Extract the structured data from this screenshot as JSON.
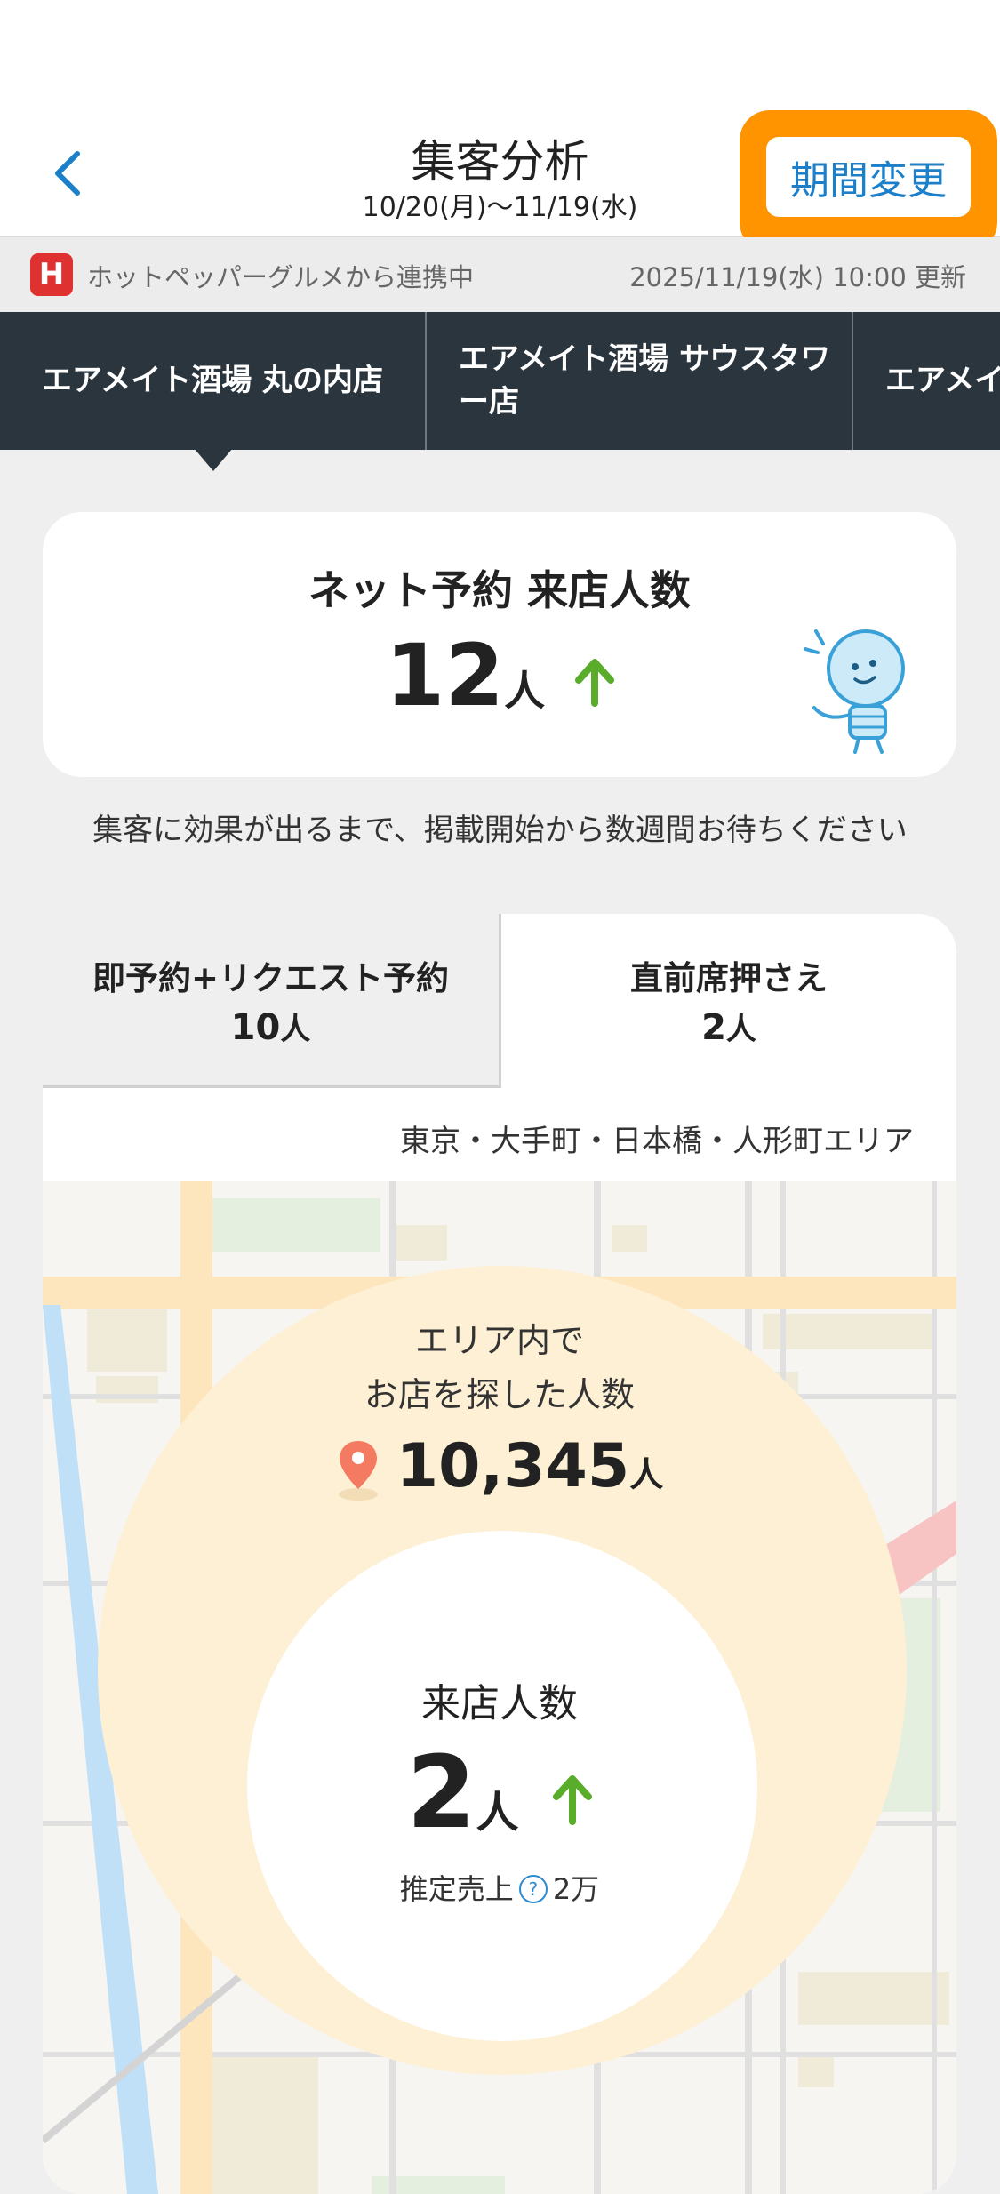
{
  "header": {
    "title": "集客分析",
    "subtitle": "10/20(月)〜11/19(水)",
    "period_button": "期間変更"
  },
  "sync": {
    "logo_letter": "H",
    "source_text": "ホットペッパーグルメから連携中",
    "updated_text": "2025/11/19(水) 10:00 更新"
  },
  "store_tabs": [
    {
      "label": "エアメイト酒場 丸の内店",
      "selected": true
    },
    {
      "label": "エアメイト酒場 サウスタワー店",
      "selected": false
    },
    {
      "label": "エアメイ",
      "selected": false
    }
  ],
  "net_card": {
    "title": "ネット予約 来店人数",
    "value": "12",
    "unit": "人",
    "trend": "up",
    "mascot": "lightbulb-mascot-icon"
  },
  "note": "集客に効果が出るまで、掲載開始から数週間お待ちください",
  "segments": [
    {
      "label": "即予約+リクエスト予約",
      "value": "10",
      "unit": "人",
      "selected": false
    },
    {
      "label": "直前席押さえ",
      "value": "2",
      "unit": "人",
      "selected": true
    }
  ],
  "area": {
    "name": "東京・大手町・日本橋・人形町エリア",
    "search_label_line1": "エリア内で",
    "search_label_line2": "お店を探した人数",
    "search_value": "10,345",
    "search_unit": "人",
    "visit_label": "来店人数",
    "visit_value": "2",
    "visit_unit": "人",
    "visit_trend": "up",
    "sales_label": "推定売上",
    "sales_value": "2万"
  },
  "colors": {
    "accent_orange": "#ff9300",
    "link_blue": "#1b7fc9",
    "trend_green": "#5aad2a",
    "tab_dark": "#2b353d",
    "circle_fill": "#fdf0d4"
  }
}
